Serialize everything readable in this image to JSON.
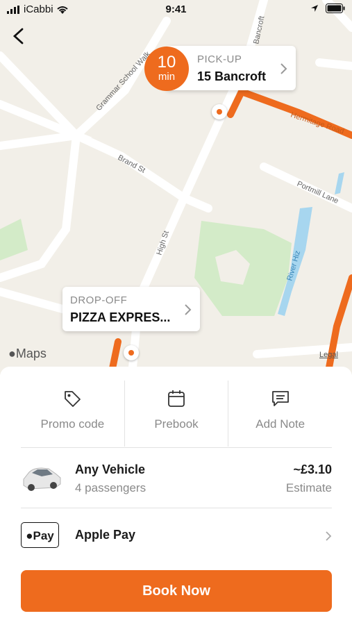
{
  "status_bar": {
    "carrier": "iCabbi",
    "time": "9:41"
  },
  "map": {
    "street_labels": [
      "Grammar School Walk",
      "Bancroft",
      "Brand St",
      "High St",
      "Portmill Lane",
      "River Hiz",
      "Hermitage Road"
    ],
    "attribution": "Maps",
    "legal": "Legal"
  },
  "pickup": {
    "eta_value": "10",
    "eta_unit": "min",
    "label": "PICK-UP",
    "address": "15 Bancroft"
  },
  "dropoff": {
    "label": "DROP-OFF",
    "address": "PIZZA EXPRES..."
  },
  "options": [
    {
      "label": "Promo code",
      "icon": "tag-icon"
    },
    {
      "label": "Prebook",
      "icon": "calendar-icon"
    },
    {
      "label": "Add Note",
      "icon": "note-icon"
    }
  ],
  "vehicle": {
    "name": "Any Vehicle",
    "passengers": "4 passengers",
    "price": "~£3.10",
    "price_note": "Estimate"
  },
  "payment": {
    "badge": "Pay",
    "method": "Apple Pay"
  },
  "book_button": "Book Now",
  "colors": {
    "accent": "#ee6b1e",
    "park": "#cfe8c6",
    "water": "#9fd3ee"
  }
}
